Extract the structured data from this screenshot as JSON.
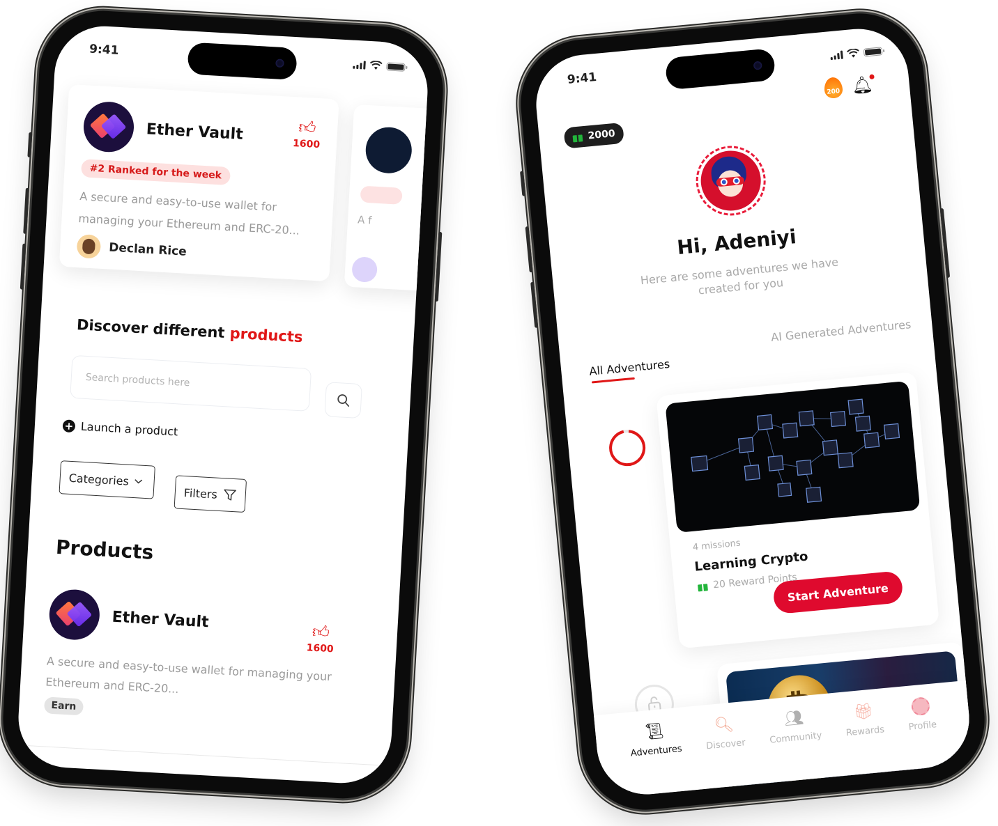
{
  "status_bar": {
    "time": "9:41"
  },
  "left_screen": {
    "featured_card": {
      "title": "Ether Vault",
      "likes": "1600",
      "rank_badge": "#2 Ranked for the week",
      "description": "A secure and easy-to-use wallet for managing your Ethereum and ERC-20...",
      "author": "Declan Rice"
    },
    "peek_card": {
      "description_fragment": "A f"
    },
    "discover": {
      "heading_prefix": "Discover different",
      "heading_highlight": "products"
    },
    "search": {
      "placeholder": "Search products here",
      "value": ""
    },
    "launch_label": "Launch a product",
    "categories_label": "Categories",
    "filters_label": "Filters",
    "products_title": "Products",
    "product_item": {
      "title": "Ether Vault",
      "likes": "1600",
      "description": "A secure and easy-to-use wallet for managing your Ethereum and ERC-20...",
      "tag": "Earn"
    },
    "colors": {
      "accent": "#e01717",
      "logo_bg": "#1c0f3d"
    }
  },
  "right_screen": {
    "points": "2000",
    "streak": "200",
    "greeting": "Hi, Adeniyi",
    "sub_greeting": "Here are some adventures we have created for you",
    "tabs": [
      {
        "label": "All Adventures",
        "active": true
      },
      {
        "label": "AI Generated Adventures",
        "active": false
      }
    ],
    "adventure": {
      "missions": "4 missions",
      "title": "Learning Crypto",
      "reward": "20 Reward Points",
      "cta": "Start Adventure",
      "progress": 0.95
    },
    "bottom_nav": [
      {
        "label": "Adventures",
        "icon": "map-scroll-icon",
        "active": true
      },
      {
        "label": "Discover",
        "icon": "discover-search-icon",
        "active": false
      },
      {
        "label": "Community",
        "icon": "community-icon",
        "active": false
      },
      {
        "label": "Rewards",
        "icon": "gift-icon",
        "active": false
      },
      {
        "label": "Profile",
        "icon": "profile-avatar-icon",
        "active": false
      }
    ],
    "colors": {
      "accent": "#df0a2e",
      "reward_green": "#22b53b",
      "chip_bg": "#1e1e1e"
    }
  }
}
